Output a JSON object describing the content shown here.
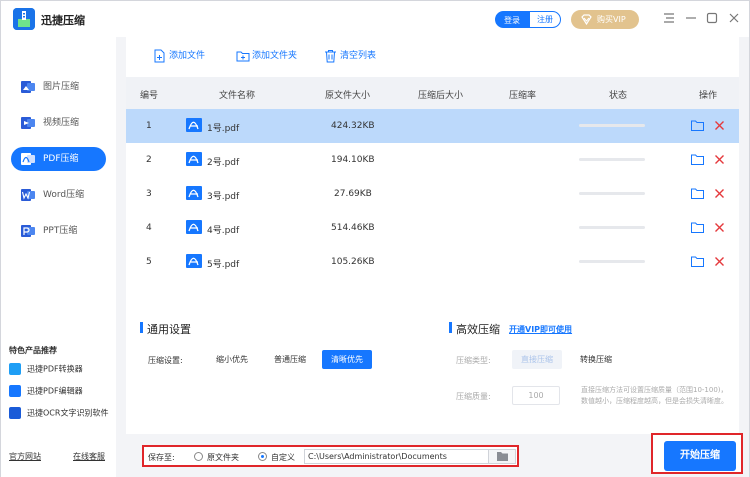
{
  "app": {
    "title": "迅捷压缩"
  },
  "header": {
    "login_label": "登录",
    "register_label": "注册",
    "vip_label": "购买VIP"
  },
  "sidebar": {
    "items": [
      {
        "label": "图片压缩",
        "icon": "image-icon",
        "active": false
      },
      {
        "label": "视频压缩",
        "icon": "video-icon",
        "active": false
      },
      {
        "label": "PDF压缩",
        "icon": "pdf-icon",
        "active": true
      },
      {
        "label": "Word压缩",
        "icon": "word-icon",
        "active": false
      },
      {
        "label": "PPT压缩",
        "icon": "ppt-icon",
        "active": false
      }
    ],
    "featured_title": "特色产品推荐",
    "products": [
      {
        "label": "迅捷PDF转换器",
        "icon": "pdf-converter-icon",
        "color": "#1e9ef5"
      },
      {
        "label": "迅捷PDF编辑器",
        "icon": "pdf-editor-icon",
        "color": "#1677ff"
      },
      {
        "label": "迅捷OCR文字识别软件",
        "icon": "ocr-icon",
        "color": "#1a5bd8"
      }
    ],
    "footer": {
      "website": "官方网站",
      "support": "在线客服"
    }
  },
  "toolbar": {
    "add_file": "添加文件",
    "add_folder": "添加文件夹",
    "clear_list": "清空列表"
  },
  "table": {
    "headers": [
      "编号",
      "文件名称",
      "原文件大小",
      "压缩后大小",
      "压缩率",
      "状态",
      "操作"
    ],
    "rows": [
      {
        "index": "1",
        "name": "1号.pdf",
        "original_size": "424.32KB",
        "compressed_size": "",
        "ratio": "",
        "selected": true
      },
      {
        "index": "2",
        "name": "2号.pdf",
        "original_size": "194.10KB",
        "compressed_size": "",
        "ratio": "",
        "selected": false
      },
      {
        "index": "3",
        "name": "3号.pdf",
        "original_size": "27.69KB",
        "compressed_size": "",
        "ratio": "",
        "selected": false
      },
      {
        "index": "4",
        "name": "4号.pdf",
        "original_size": "514.46KB",
        "compressed_size": "",
        "ratio": "",
        "selected": false
      },
      {
        "index": "5",
        "name": "5号.pdf",
        "original_size": "105.26KB",
        "compressed_size": "",
        "ratio": "",
        "selected": false
      }
    ]
  },
  "settings": {
    "general_title": "通用设置",
    "compress_setting_label": "压缩设置:",
    "options": [
      "缩小优先",
      "普通压缩",
      "清晰优先"
    ],
    "selected_option": "清晰优先",
    "efficient_title": "高效压缩",
    "vip_link": "开通VIP即可使用",
    "compress_type_label": "压缩类型:",
    "type_options": [
      "直接压缩",
      "转换压缩"
    ],
    "quality_label": "压缩质量:",
    "quality_value": "100",
    "description": "直接压缩方法可设置压缩质量（范围10-100)，数值越小，压缩程度越高，但是会损失清晰度。"
  },
  "save": {
    "label": "保存至:",
    "option_original": "原文件夹",
    "option_custom": "自定义",
    "selected": "自定义",
    "path": "C:\\Users\\Administrator\\Documents"
  },
  "start_button": "开始压缩",
  "colors": {
    "accent": "#1677ff",
    "selected_row": "#bcd9fb",
    "highlight_border": "#e0262a",
    "vip_gold": "#e2c38e",
    "delete_red": "#e5393c"
  }
}
